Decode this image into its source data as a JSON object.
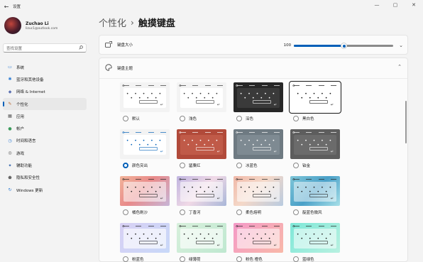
{
  "window": {
    "title": "设置",
    "back": "←",
    "controls": [
      "—",
      "▢",
      "✕"
    ]
  },
  "profile": {
    "name": "Zuchao Li",
    "email": "lizuc1@outlook.com"
  },
  "search": {
    "placeholder": "查找设置",
    "icon": "search-icon"
  },
  "nav": [
    {
      "label": "系统",
      "icon": "▭",
      "color": "#2b7bd4"
    },
    {
      "label": "蓝牙和其他设备",
      "icon": "✱",
      "color": "#2b7bd4"
    },
    {
      "label": "网络 & Internet",
      "icon": "◆",
      "color": "#5a6fb0"
    },
    {
      "label": "个性化",
      "icon": "✎",
      "color": "#b8652e",
      "active": true
    },
    {
      "label": "应用",
      "icon": "▦",
      "color": "#555"
    },
    {
      "label": "帐户",
      "icon": "●",
      "color": "#3b9b5c"
    },
    {
      "label": "时间和语言",
      "icon": "◷",
      "color": "#2b7bd4"
    },
    {
      "label": "游戏",
      "icon": "◎",
      "color": "#555"
    },
    {
      "label": "辅助功能",
      "icon": "✦",
      "color": "#2b5fa8"
    },
    {
      "label": "隐私和安全性",
      "icon": "⬟",
      "color": "#666"
    },
    {
      "label": "Windows 更新",
      "icon": "↻",
      "color": "#2b7bd4"
    }
  ],
  "breadcrumb": {
    "parent": "个性化",
    "separator": "›",
    "current": "触摸键盘"
  },
  "keyboard_size": {
    "label": "键盘大小",
    "value": "100",
    "level_percent": 50,
    "icon": "keyboard-size-icon"
  },
  "keyboard_theme": {
    "label": "键盘主题",
    "icon": "palette-icon"
  },
  "themes": [
    {
      "name": "默认",
      "bg": "#f3f3f3",
      "pane": "#ffffff",
      "fg": "#333333",
      "selected": false
    },
    {
      "name": "浅色",
      "bg": "#f3f3f3",
      "pane": "#ffffff",
      "fg": "#333333",
      "selected": false
    },
    {
      "name": "深色",
      "bg": "#272727",
      "pane": "#3a3a3a",
      "fg": "#ffffff",
      "selected": false
    },
    {
      "name": "黑白色",
      "bg": "#ffffff",
      "pane": "#ffffff",
      "fg": "#111111",
      "selected": false,
      "border": true
    },
    {
      "name": "颜色突出",
      "bg": "#f3f3f3",
      "pane": "#ffffff",
      "fg": "#005fb8",
      "selected": true
    },
    {
      "name": "罂粟红",
      "bg": "#b14a3a",
      "pane": "#c05a48",
      "fg": "#ffffff",
      "selected": false
    },
    {
      "name": "冰蓝色",
      "bg": "#6e7a82",
      "pane": "#7e8a92",
      "fg": "#ffffff",
      "selected": false
    },
    {
      "name": "铂金",
      "bg": "#5d5d5d",
      "pane": "#6b6b6b",
      "fg": "#ffffff",
      "selected": false
    },
    {
      "name": "橘色刷沙",
      "bg": "linear-gradient(135deg,#f2b49a,#e88a8a 45%,#c7b6d8)",
      "pane": "rgba(255,255,255,0.55)",
      "fg": "#222222",
      "selected": false
    },
    {
      "name": "丁香河",
      "bg": "linear-gradient(135deg,#bfb4e0,#f0d9e6 50%,#a8b6d8)",
      "pane": "rgba(255,255,255,0.55)",
      "fg": "#222222",
      "selected": false
    },
    {
      "name": "柔色熔明",
      "bg": "linear-gradient(135deg,#f0b8a8,#f4d8c8 45%,#b8cbe0)",
      "pane": "rgba(255,255,255,0.55)",
      "fg": "#222222",
      "selected": false
    },
    {
      "name": "靛蓝色微风",
      "bg": "linear-gradient(135deg,#7fc6d8,#4aa0c8 50%,#a8e0e8)",
      "pane": "rgba(255,255,255,0.5)",
      "fg": "#222222",
      "selected": false
    },
    {
      "name": "粉蓝色",
      "bg": "linear-gradient(135deg,#d8d0f4,#c8d8f8)",
      "pane": "rgba(255,255,255,0.65)",
      "fg": "#222222",
      "selected": false
    },
    {
      "name": "绿薄荷",
      "bg": "linear-gradient(135deg,#d8f0dc,#bfe8d0)",
      "pane": "rgba(255,255,255,0.65)",
      "fg": "#222222",
      "selected": false
    },
    {
      "name": "粉色 橙色",
      "bg": "linear-gradient(135deg,#f49ac8,#f8b8a8)",
      "pane": "rgba(255,255,255,0.55)",
      "fg": "#222222",
      "selected": false
    },
    {
      "name": "蓝绿色",
      "bg": "linear-gradient(135deg,#7ee8d8,#b8f0e0)",
      "pane": "rgba(255,255,255,0.55)",
      "fg": "#222222",
      "selected": false
    }
  ]
}
